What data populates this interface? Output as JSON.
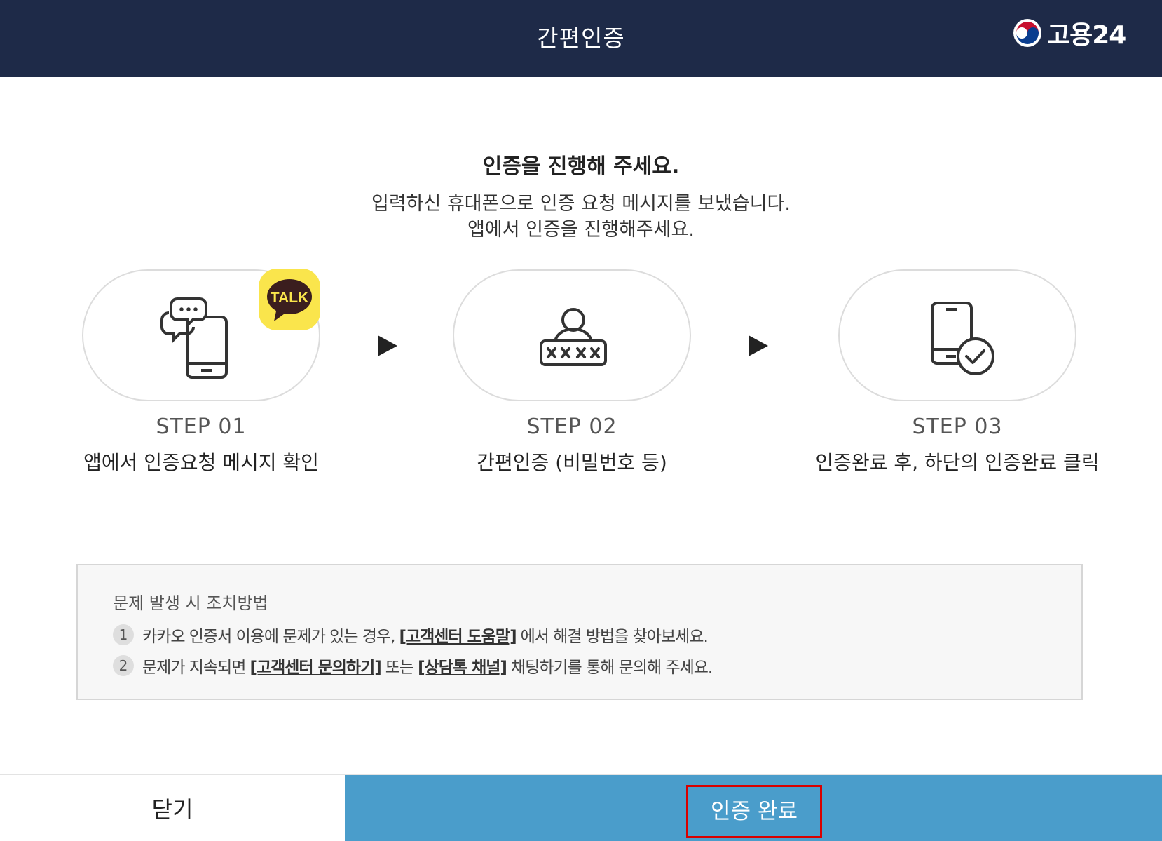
{
  "header": {
    "title": "간편인증",
    "logo_text": "고용24"
  },
  "main": {
    "title": "인증을 진행해 주세요.",
    "desc_line1": "입력하신 휴대폰으로 인증 요청 메시지를 보냈습니다.",
    "desc_line2": "앱에서 인증을 진행해주세요."
  },
  "steps": [
    {
      "number": "STEP 01",
      "desc": "앱에서 인증요청 메시지 확인",
      "icon": "phone-chat-icon",
      "badge": "TALK"
    },
    {
      "number": "STEP 02",
      "desc": "간편인증 (비밀번호 등)",
      "icon": "user-password-icon"
    },
    {
      "number": "STEP 03",
      "desc": "인증완료 후, 하단의 인증완료 클릭",
      "icon": "phone-check-icon"
    }
  ],
  "notice": {
    "title": "문제 발생 시 조치방법",
    "items": [
      {
        "num": "1",
        "pre": "카카오 인증서 이용에 문제가 있는 경우,",
        "link": "[고객센터 도움말]",
        "post": "에서 해결 방법을 찾아보세요."
      },
      {
        "num": "2",
        "pre": "문제가 지속되면",
        "link": "[고객센터 문의하기]",
        "mid": "또는",
        "link2": "[상담톡 채널]",
        "post": "채팅하기를 통해 문의해 주세요."
      }
    ]
  },
  "footer": {
    "close_label": "닫기",
    "confirm_label": "인증 완료"
  },
  "colors": {
    "header_bg": "#1e2a48",
    "confirm_bg": "#4a9dcb",
    "talk_yellow": "#fae54c",
    "highlight": "#d90000"
  }
}
